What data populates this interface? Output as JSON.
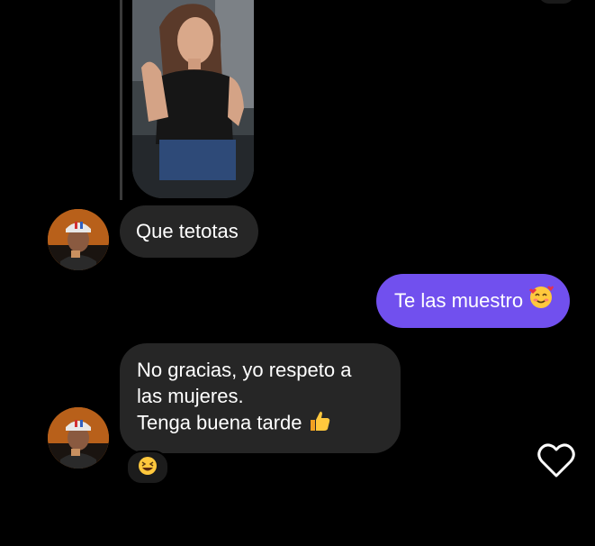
{
  "messages": [
    {
      "sender": "other",
      "text": "Que tetotas"
    },
    {
      "sender": "me",
      "text": "Te las muestro",
      "emoji_icon": "smiling-face-with-hearts-icon"
    },
    {
      "sender": "other",
      "lines": [
        "No gracias, yo respeto a",
        "las mujeres.",
        "Tenga buena tarde"
      ],
      "emoji_icon": "thumbs-up-icon"
    }
  ],
  "reaction": {
    "icon": "grinning-squinting-face-icon"
  },
  "colors": {
    "background": "#000000",
    "incoming_bubble": "#262626",
    "outgoing_bubble": "#7150ee",
    "text": "#ffffff"
  }
}
